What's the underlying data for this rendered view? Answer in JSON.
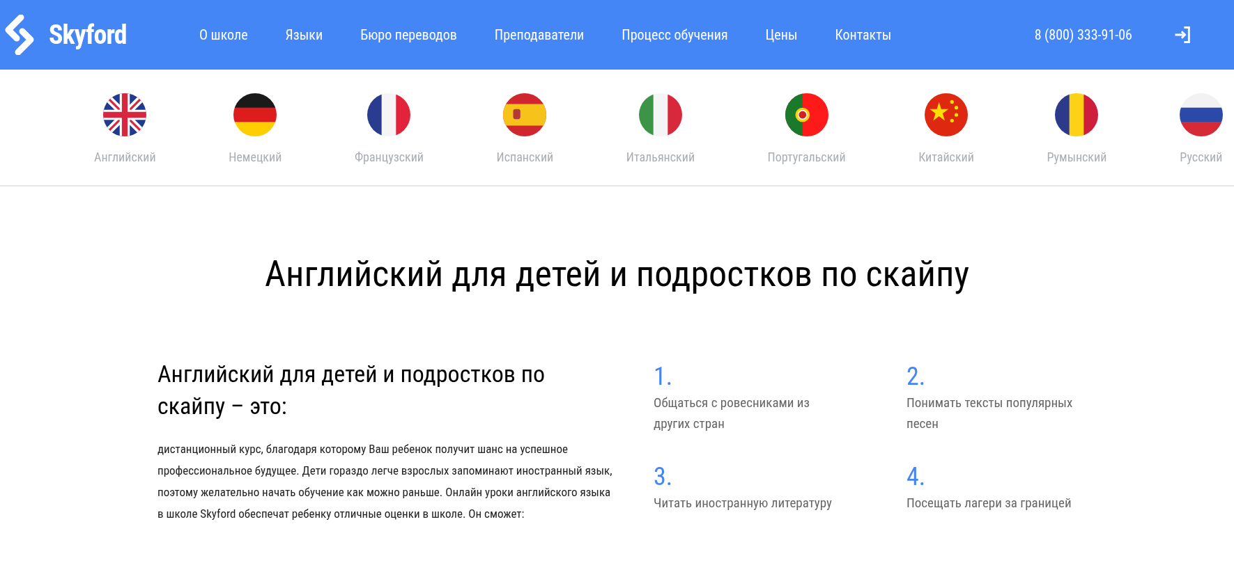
{
  "header": {
    "logo": "Skyford",
    "nav": [
      "О школе",
      "Языки",
      "Бюро переводов",
      "Преподаватели",
      "Процесс обучения",
      "Цены",
      "Контакты"
    ],
    "phone": "8 (800) 333-91-06"
  },
  "languages": [
    {
      "label": "Английский",
      "kind": "uk"
    },
    {
      "label": "Немецкий",
      "kind": "de"
    },
    {
      "label": "Французский",
      "kind": "fr"
    },
    {
      "label": "Испанский",
      "kind": "es"
    },
    {
      "label": "Итальянский",
      "kind": "it"
    },
    {
      "label": "Португальский",
      "kind": "pt"
    },
    {
      "label": "Китайский",
      "kind": "cn"
    },
    {
      "label": "Румынский",
      "kind": "ro"
    },
    {
      "label": "Русский",
      "kind": "ru"
    }
  ],
  "title": "Английский для детей и подростков по скайпу",
  "intro": {
    "heading": "Английский для детей и подростков по скайпу – это:",
    "text": "дистанционный курс, благодаря которому Ваш ребенок получит шанс на успешное профессиональное будущее. Дети гораздо легче взрослых запоминают иностранный язык, поэтому желательно начать обучение как можно раньше. Онлайн уроки английского языка в школе Skyford обеспечат ребенку отличные оценки в школе. Он сможет:"
  },
  "benefits": [
    {
      "number": "1.",
      "text": "Общаться с ровесниками из других стран"
    },
    {
      "number": "2.",
      "text": "Понимать тексты популярных песен"
    },
    {
      "number": "3.",
      "text": "Читать иностранную литературу"
    },
    {
      "number": "4.",
      "text": "Посещать лагери за границей"
    }
  ]
}
